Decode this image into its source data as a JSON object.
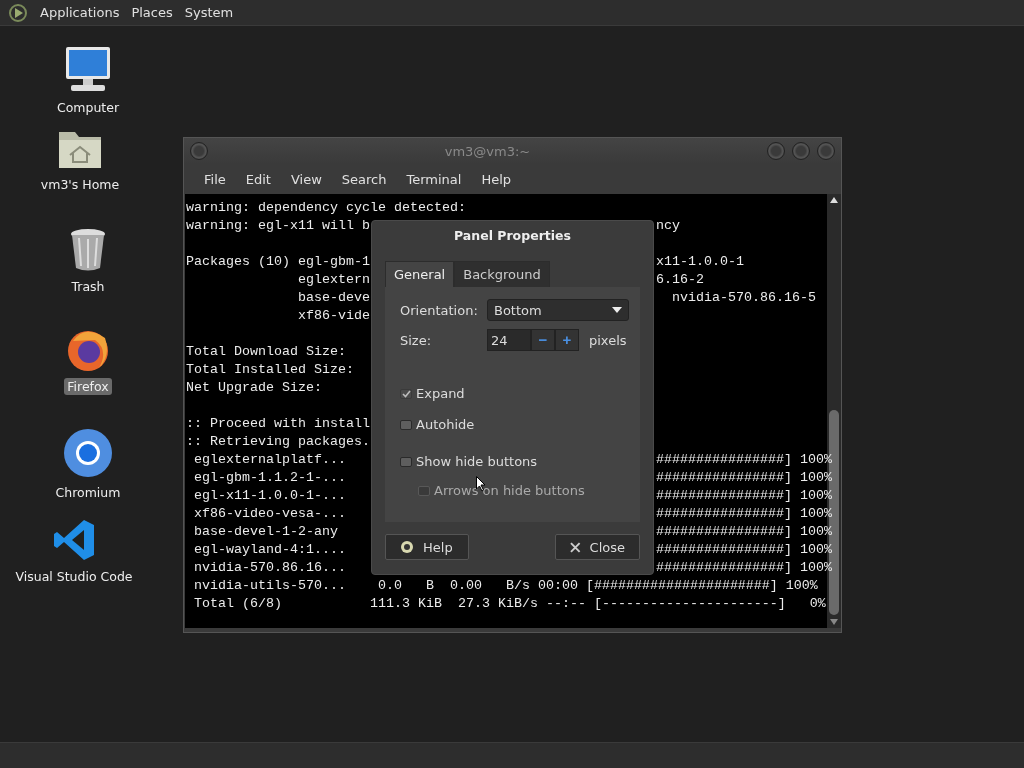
{
  "top_panel": {
    "menus": [
      "Applications",
      "Places",
      "System"
    ]
  },
  "desktop_icons": [
    {
      "label": "Computer",
      "kind": "computer",
      "selected": false
    },
    {
      "label": "vm3's Home",
      "kind": "home",
      "selected": false
    },
    {
      "label": "Trash",
      "kind": "trash",
      "selected": false
    },
    {
      "label": "Firefox",
      "kind": "firefox",
      "selected": true
    },
    {
      "label": "Chromium",
      "kind": "chromium",
      "selected": false
    },
    {
      "label": "Visual Studio Code",
      "kind": "vscode",
      "selected": false
    }
  ],
  "terminal": {
    "title": "vm3@vm3:~",
    "menu": [
      "File",
      "Edit",
      "View",
      "Search",
      "Terminal",
      "Help"
    ],
    "lines": [
      {
        "kind": "full",
        "left": "warning: dependency cycle detected:"
      },
      {
        "kind": "split",
        "left": "warning: egl-x11 will b",
        "right": "ncy"
      },
      {
        "kind": "blank"
      },
      {
        "kind": "split",
        "left": "Packages (10) egl-gbm-1",
        "right": "x11-1.0.0-1"
      },
      {
        "kind": "split",
        "left": "              eglextern",
        "right": "6.16-2"
      },
      {
        "kind": "split",
        "left": "              base-deve",
        "right": "  nvidia-570.86.16-5"
      },
      {
        "kind": "split",
        "left": "              xf86-vide"
      },
      {
        "kind": "blank"
      },
      {
        "kind": "split",
        "left": "Total Download Size:"
      },
      {
        "kind": "split",
        "left": "Total Installed Size:"
      },
      {
        "kind": "split",
        "left": "Net Upgrade Size:"
      },
      {
        "kind": "blank"
      },
      {
        "kind": "split",
        "left": ":: Proceed with install"
      },
      {
        "kind": "split",
        "left": ":: Retrieving packages."
      },
      {
        "kind": "split",
        "left": " eglexternalplatf...",
        "right": "################] 100%"
      },
      {
        "kind": "split",
        "left": " egl-gbm-1.1.2-1-...",
        "right": "################] 100%"
      },
      {
        "kind": "split",
        "left": " egl-x11-1.0.0-1-...",
        "right": "################] 100%"
      },
      {
        "kind": "split",
        "left": " xf86-video-vesa-...",
        "right": "################] 100%"
      },
      {
        "kind": "split",
        "left": " base-devel-1-2-any",
        "right": "################] 100%"
      },
      {
        "kind": "split",
        "left": " egl-wayland-4:1....",
        "right": "################] 100%"
      },
      {
        "kind": "split",
        "left": " nvidia-570.86.16...",
        "right": "################] 100%"
      },
      {
        "kind": "full",
        "left": " nvidia-utils-570...    0.0   B  0.00   B/s 00:00 [######################] 100%"
      },
      {
        "kind": "full",
        "left": " Total (6/8)           111.3 KiB  27.3 KiB/s --:-- [----------------------]   0%"
      }
    ]
  },
  "dialog": {
    "title": "Panel Properties",
    "tabs": [
      {
        "label": "General",
        "selected": true
      },
      {
        "label": "Background",
        "selected": false
      }
    ],
    "orientation": {
      "label": "Orientation:",
      "value": "Bottom"
    },
    "size": {
      "label": "Size:",
      "value": "24",
      "unit": "pixels",
      "minus": "−",
      "plus": "+"
    },
    "options": [
      {
        "label": "Expand",
        "checked": true,
        "disabled": false
      },
      {
        "label": "Autohide",
        "checked": false,
        "disabled": false
      },
      {
        "label": "Show hide buttons",
        "checked": false,
        "disabled": false,
        "children": [
          {
            "label": "Arrows on hide buttons",
            "checked": false,
            "disabled": true
          }
        ]
      }
    ],
    "buttons": [
      {
        "label": "Help",
        "kind": "help"
      },
      {
        "label": "Close",
        "kind": "close"
      }
    ]
  }
}
